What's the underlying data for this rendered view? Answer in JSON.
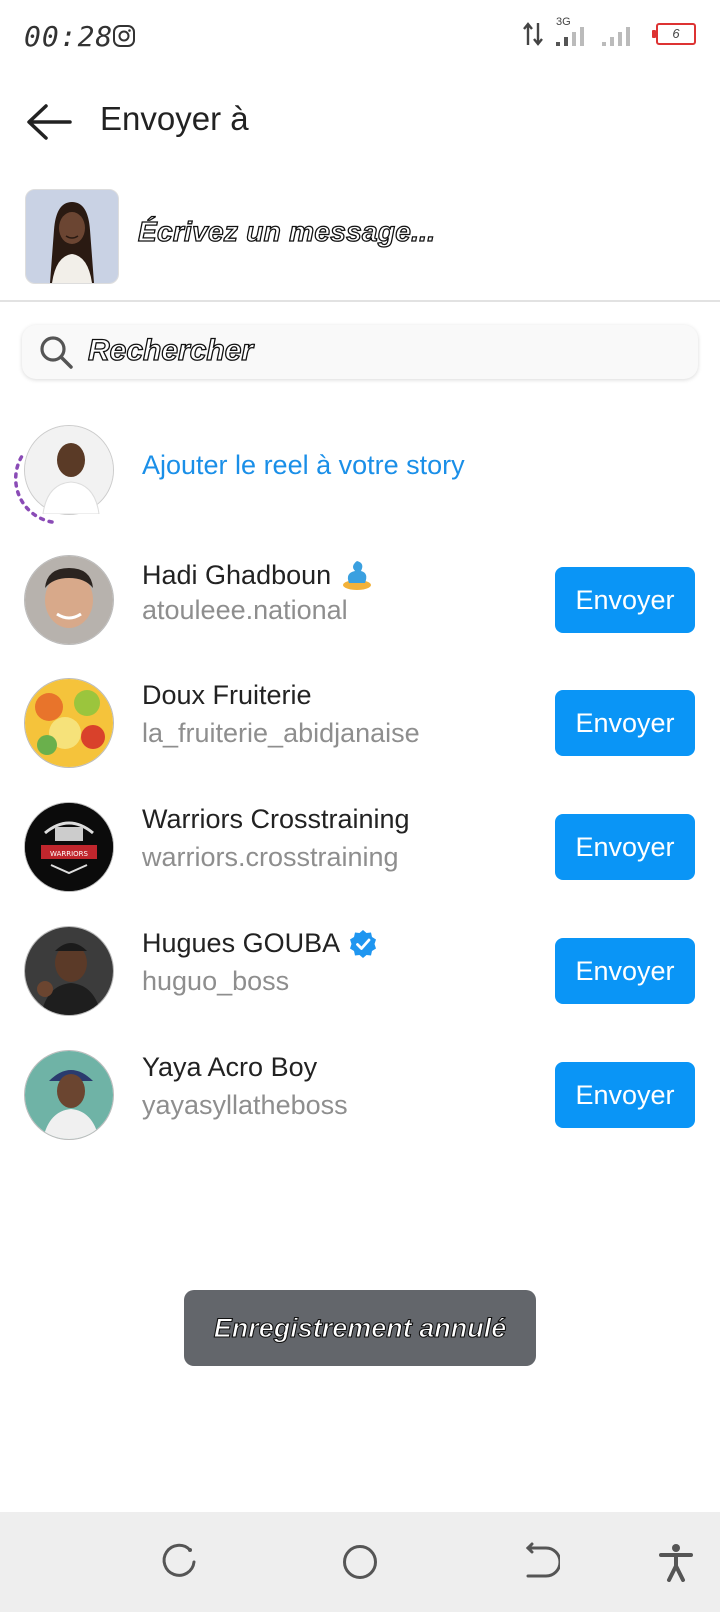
{
  "status_bar": {
    "time": "00:28",
    "network": "3G",
    "battery": "6",
    "colors": {
      "battery_low": "#dd3333"
    }
  },
  "header": {
    "title": "Envoyer à"
  },
  "message": {
    "placeholder": "Écrivez un message..."
  },
  "search": {
    "placeholder": "Rechercher"
  },
  "story": {
    "label": "Ajouter le reel à votre story"
  },
  "contacts": [
    {
      "name": "Hadi Ghadboun",
      "username": "atouleee.national",
      "button": "Envoyer",
      "badge": "genie-icon"
    },
    {
      "name": "Doux Fruiterie",
      "username": "la_fruiterie_abidjanaise",
      "button": "Envoyer"
    },
    {
      "name": "Warriors Crosstraining",
      "username": "warriors.crosstraining",
      "button": "Envoyer",
      "avatar_text": "WARRIORS"
    },
    {
      "name": "Hugues GOUBA",
      "username": "huguo_boss",
      "button": "Envoyer",
      "badge": "verified-icon"
    },
    {
      "name": "Yaya Acro Boy",
      "username": "yayasyllatheboss",
      "button": "Envoyer"
    }
  ],
  "toast": {
    "text": "Enregistrement annulé"
  },
  "colors": {
    "accent": "#0a95f6",
    "link": "#1a8fe8",
    "toast_bg": "#63666b"
  }
}
